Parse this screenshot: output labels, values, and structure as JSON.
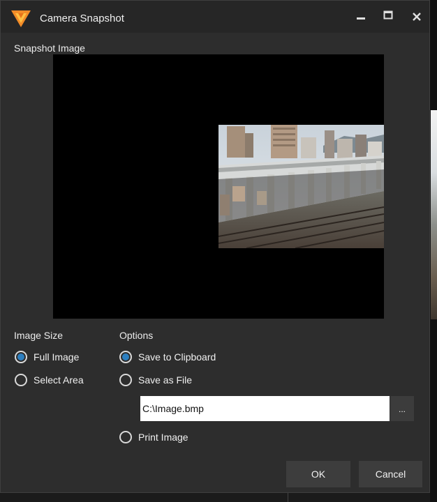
{
  "window": {
    "title": "Camera Snapshot",
    "controls": {
      "minimize": "▁",
      "maximize": "▭",
      "close": "✕"
    },
    "icon": "app-logo-icon"
  },
  "snapshot": {
    "label": "Snapshot Image"
  },
  "image_size": {
    "label": "Image Size",
    "options": [
      {
        "label": "Full Image",
        "checked": true
      },
      {
        "label": "Select Area",
        "checked": false
      }
    ]
  },
  "options": {
    "label": "Options",
    "save_to_clipboard": {
      "label": "Save to Clipboard",
      "checked": true
    },
    "save_as_file": {
      "label": "Save as File",
      "checked": false
    },
    "file_path": "C:\\Image.bmp",
    "browse_label": "...",
    "print_image": {
      "label": "Print Image",
      "checked": false
    }
  },
  "buttons": {
    "ok": "OK",
    "cancel": "Cancel"
  },
  "colors": {
    "accent": "#2d7fc0",
    "dialog_bg": "#2d2d2d",
    "titlebar_bg": "#262626",
    "logo_orange": "#f28c28"
  }
}
